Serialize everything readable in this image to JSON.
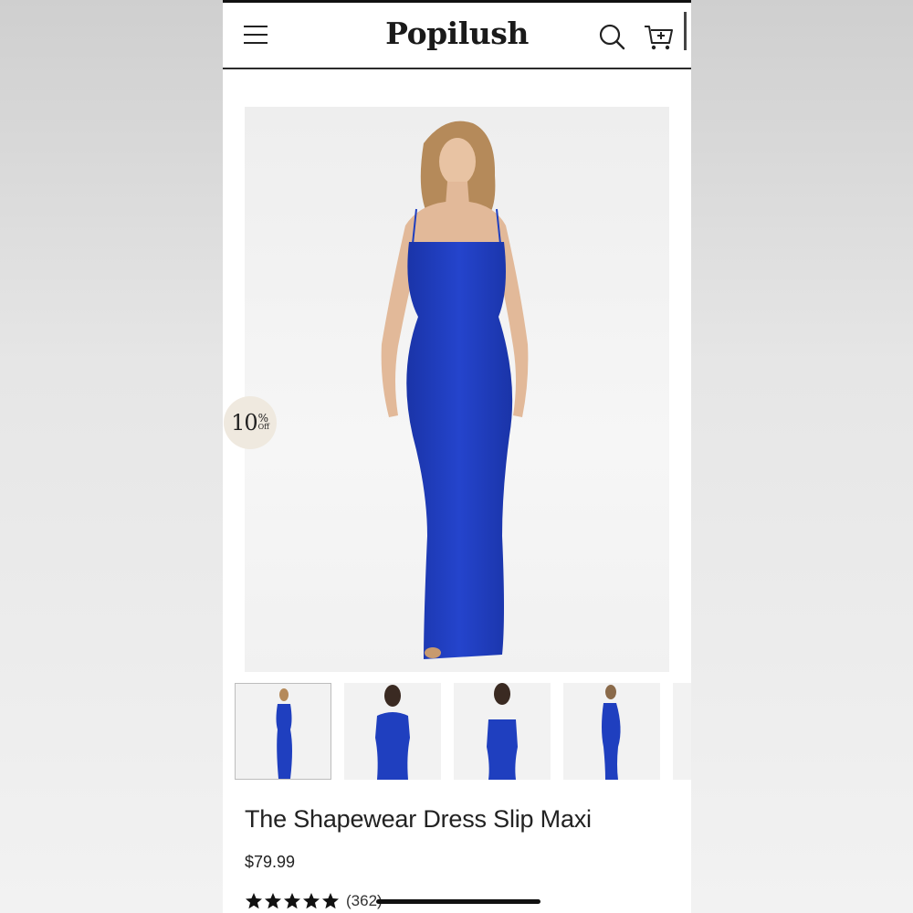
{
  "header": {
    "logo": "Popilush",
    "menu_icon": "hamburger-menu-icon",
    "search_icon": "search-icon",
    "cart_icon": "cart-plus-icon"
  },
  "hero": {
    "badge_number": "10",
    "badge_percent": "%",
    "badge_off": "Off",
    "dress_color": "#1f3fbf"
  },
  "thumbnails": [
    {
      "view": "front"
    },
    {
      "view": "front-close"
    },
    {
      "view": "back"
    },
    {
      "view": "back-side"
    },
    {
      "view": "partial"
    }
  ],
  "product": {
    "title": "The Shapewear Dress Slip Maxi",
    "price": "$79.99",
    "rating_stars": 5,
    "review_count": "(362)"
  }
}
